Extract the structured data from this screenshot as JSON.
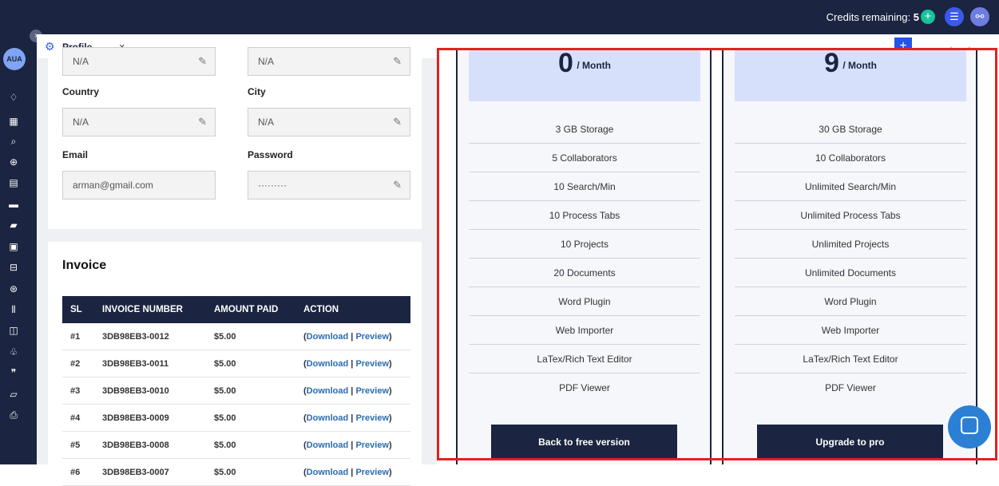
{
  "topbar": {
    "credits_label": "Credits remaining:",
    "credits_value": "5",
    "add_credits_icon": "plus-circle-icon",
    "list_icon": "list-icon",
    "graph_icon": "graph-icon"
  },
  "sidebar": {
    "avatar": "AUA",
    "icons": [
      "bell-icon",
      "dashboard-icon",
      "search-icon",
      "zoom-icon",
      "document-icon",
      "folder-icon",
      "folder-alt-icon",
      "image-icon",
      "process-icon",
      "globe-icon",
      "library-icon",
      "file-icon",
      "share-icon",
      "quote-icon",
      "note-icon",
      "export-icon"
    ]
  },
  "tab": {
    "label": "Profile",
    "close": "×"
  },
  "profile": {
    "top_field_1": "N/A",
    "top_field_2": "N/A",
    "country_label": "Country",
    "country_value": "N/A",
    "city_label": "City",
    "city_value": "N/A",
    "email_label": "Email",
    "email_value": "arman@gmail.com",
    "password_label": "Password",
    "password_value": "·········"
  },
  "invoice": {
    "title": "Invoice",
    "headers": [
      "SL",
      "INVOICE NUMBER",
      "AMOUNT PAID",
      "ACTION"
    ],
    "rows": [
      {
        "sl": "#1",
        "number": "3DB98EB3-0012",
        "amount": "$5.00"
      },
      {
        "sl": "#2",
        "number": "3DB98EB3-0011",
        "amount": "$5.00"
      },
      {
        "sl": "#3",
        "number": "3DB98EB3-0010",
        "amount": "$5.00"
      },
      {
        "sl": "#4",
        "number": "3DB98EB3-0009",
        "amount": "$5.00"
      },
      {
        "sl": "#5",
        "number": "3DB98EB3-0008",
        "amount": "$5.00"
      },
      {
        "sl": "#6",
        "number": "3DB98EB3-0007",
        "amount": "$5.00"
      }
    ],
    "action_download": "Download",
    "action_preview": "Preview"
  },
  "pricing": {
    "free": {
      "price": "0",
      "period": "/ Month",
      "features": [
        "3 GB Storage",
        "5 Collaborators",
        "10 Search/Min",
        "10 Process Tabs",
        "10 Projects",
        "20 Documents",
        "Word Plugin",
        "Web Importer",
        "LaTex/Rich Text Editor",
        "PDF Viewer"
      ],
      "button": "Back to free version"
    },
    "pro": {
      "price": "9",
      "period": "/ Month",
      "features": [
        "30 GB Storage",
        "10 Collaborators",
        "Unlimited Search/Min",
        "Unlimited Process Tabs",
        "Unlimited Projects",
        "Unlimited Documents",
        "Word Plugin",
        "Web Importer",
        "LaTex/Rich Text Editor",
        "PDF Viewer"
      ],
      "button": "Upgrade to pro"
    }
  },
  "colors": {
    "navy": "#1b2440",
    "accent_blue": "#2453e8",
    "highlight_red": "#e12222",
    "price_header": "#d7e0fb"
  }
}
